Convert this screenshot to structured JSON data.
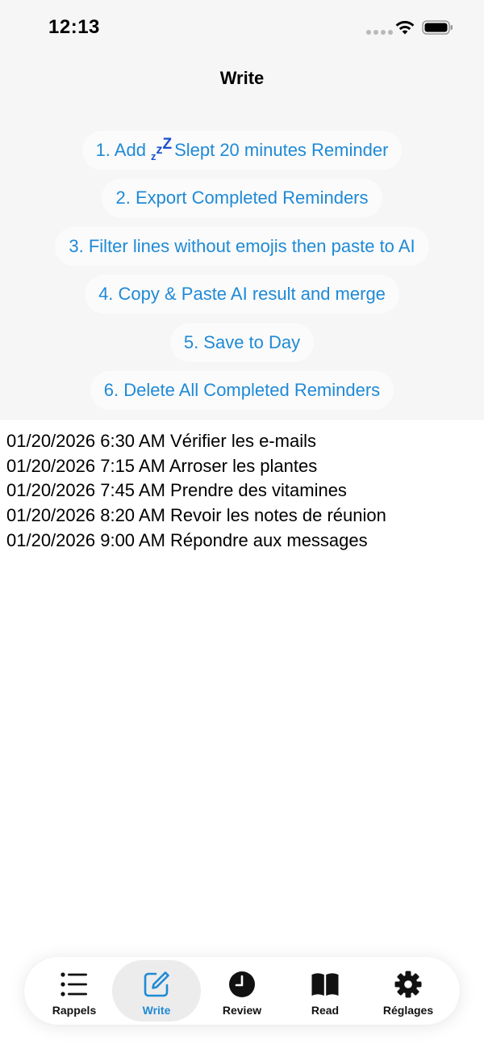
{
  "status_bar": {
    "time": "12:13"
  },
  "nav": {
    "title": "Write"
  },
  "actions": [
    {
      "prefix": "1. Add",
      "icon": "zzz-sleep-icon",
      "zzz": "zzZ",
      "suffix": "Slept 20 minutes Reminder"
    },
    {
      "label": "2. Export Completed Reminders"
    },
    {
      "label": "3. Filter lines without emojis then paste to AI"
    },
    {
      "label": "4. Copy & Paste AI result and merge"
    },
    {
      "label": "5. Save to Day"
    },
    {
      "label": "6. Delete All Completed Reminders"
    }
  ],
  "log_lines": [
    "01/20/2026 6:30 AM Vérifier les e-mails",
    "01/20/2026 7:15 AM Arroser les plantes",
    "01/20/2026 7:45 AM Prendre des vitamines",
    "01/20/2026 8:20 AM Revoir les notes de réunion",
    "01/20/2026 9:00 AM Répondre aux messages"
  ],
  "tabs": [
    {
      "label": "Rappels",
      "icon": "list-bullet-icon",
      "active": false
    },
    {
      "label": "Write",
      "icon": "square-pencil-icon",
      "active": true
    },
    {
      "label": "Review",
      "icon": "clock-icon",
      "active": false
    },
    {
      "label": "Read",
      "icon": "book-icon",
      "active": false
    },
    {
      "label": "Réglages",
      "icon": "gear-icon",
      "active": false
    }
  ],
  "colors": {
    "accent": "#1f8ad6",
    "zzz": "#1a4fd0",
    "top_background": "#f6f6f6"
  }
}
